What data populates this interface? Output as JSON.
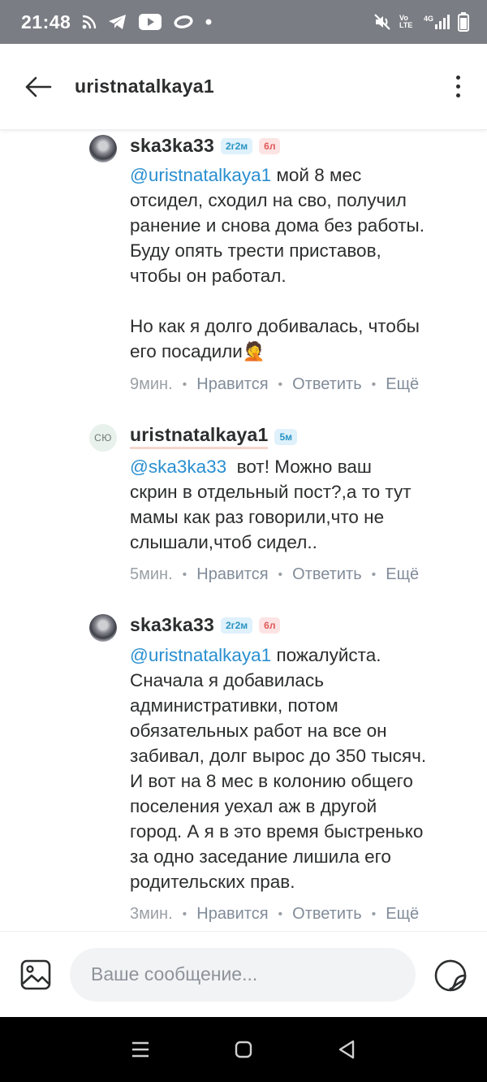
{
  "status_bar": {
    "time": "21:48",
    "left_icons": [
      "rss-icon",
      "telegram-icon",
      "youtube-icon",
      "ring-icon",
      "dot-icon"
    ],
    "right_icons": [
      "mute-icon",
      "volte-icon",
      "signal-icon",
      "battery-icon"
    ],
    "volte_label": "Vo LTE",
    "net_label": "4G"
  },
  "header": {
    "title": "uristnatalkaya1"
  },
  "comments": [
    {
      "author": "ska3ka33",
      "badges": [
        "2г2м",
        "6л"
      ],
      "lines": [
        [
          {
            "mention": "@uristnatalkaya1"
          },
          {
            "text": " мой 8 мес"
          }
        ],
        [
          {
            "text": "отсидел, сходил на сво, получил"
          }
        ],
        [
          {
            "text": "ранение и снова дома без работы."
          }
        ],
        [
          {
            "text": "Буду опять трести приставов,"
          }
        ],
        [
          {
            "text": "чтобы он работал."
          }
        ],
        [],
        [
          {
            "text": "Но как я долго добивалась, чтобы"
          }
        ],
        [
          {
            "text": "его посадили🤦"
          }
        ]
      ],
      "time": "9мин.",
      "like": "Нравится",
      "reply": "Ответить",
      "more": "Ещё"
    },
    {
      "author": "uristnatalkaya1",
      "initials": "СЮ",
      "badges": [
        "5м"
      ],
      "lines": [
        [
          {
            "mention": "@ska3ka33"
          },
          {
            "text": "  вот! Можно ваш"
          }
        ],
        [
          {
            "text": "скрин в отдельный пост?,а то тут"
          }
        ],
        [
          {
            "text": "мамы как раз говорили,что не"
          }
        ],
        [
          {
            "text": "слышали,чтоб сидел.."
          }
        ]
      ],
      "time": "5мин.",
      "like": "Нравится",
      "reply": "Ответить",
      "more": "Ещё"
    },
    {
      "author": "ska3ka33",
      "badges": [
        "2г2м",
        "6л"
      ],
      "lines": [
        [
          {
            "mention": "@uristnatalkaya1"
          },
          {
            "text": " пожалуйста."
          }
        ],
        [
          {
            "text": "Сначала я добавилась"
          }
        ],
        [
          {
            "text": "административки, потом"
          }
        ],
        [
          {
            "text": "обязательных работ на все он"
          }
        ],
        [
          {
            "text": "забивал, долг вырос до 350 тысяч."
          }
        ],
        [
          {
            "text": "И вот на 8 мес в колонию общего"
          }
        ],
        [
          {
            "text": "поселения уехал аж в другой"
          }
        ],
        [
          {
            "text": "город. А я в это время быстренько"
          }
        ],
        [
          {
            "text": "за одно заседание лишила его"
          }
        ],
        [
          {
            "text": "родительских прав."
          }
        ]
      ],
      "time": "3мин.",
      "like": "Нравится",
      "reply": "Ответить",
      "more": "Ещё"
    }
  ],
  "composer": {
    "placeholder": "Ваше сообщение..."
  },
  "nav": {
    "buttons": [
      "recents-icon",
      "home-icon",
      "back-icon"
    ]
  },
  "colors": {
    "mention": "#2a8fd0",
    "status_bar": "#7a7d83",
    "badge_blue": "#2a95c4",
    "badge_red": "#e05a5a"
  }
}
